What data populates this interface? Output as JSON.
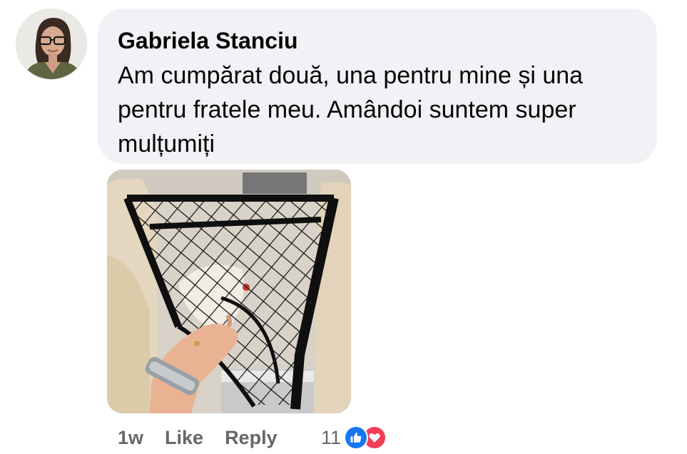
{
  "comment": {
    "author": "Gabriela Stanciu",
    "text": "Am cumpărat două, una pentru mine și una pentru fratele meu. Amândoi suntem super mulțumiți",
    "time": "1w",
    "like_label": "Like",
    "reply_label": "Reply",
    "reaction_count": "11",
    "reactions": [
      "like-icon",
      "love-icon"
    ]
  },
  "colors": {
    "bubble": "#f0f2f5",
    "meta_text": "#65676b",
    "like_blue": "#1877f2",
    "love_red": "#f33e58"
  }
}
